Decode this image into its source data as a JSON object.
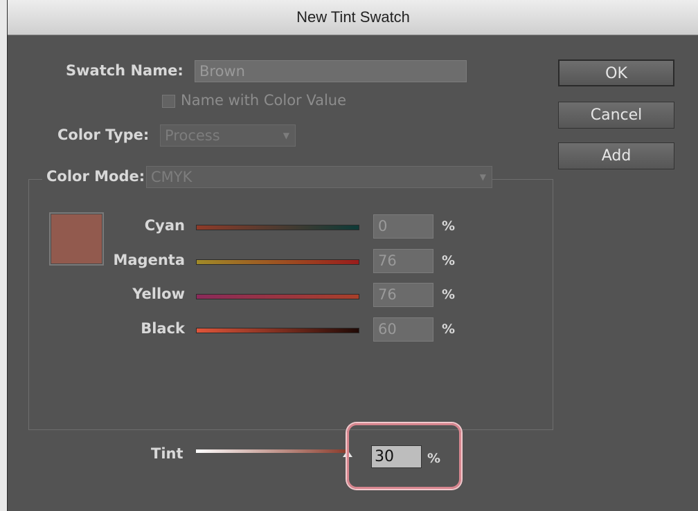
{
  "dialog": {
    "title": "New Tint Swatch"
  },
  "swatch_name": {
    "label": "Swatch Name:",
    "value": "Brown"
  },
  "name_with_color_value": {
    "label": "Name with Color Value",
    "checked": false
  },
  "color_type": {
    "label": "Color Type:",
    "value": "Process"
  },
  "color_mode": {
    "label": "Color Mode:",
    "value": "CMYK"
  },
  "swatch_color": "#925a4e",
  "channels": [
    {
      "label": "Cyan",
      "value": "0",
      "unit": "%",
      "gradient": [
        "#8e3a28",
        "#0d3a37"
      ]
    },
    {
      "label": "Magenta",
      "value": "76",
      "unit": "%",
      "gradient": [
        "#a08a28",
        "#9a1c1c"
      ]
    },
    {
      "label": "Yellow",
      "value": "76",
      "unit": "%",
      "gradient": [
        "#8a2a5a",
        "#a8402a"
      ]
    },
    {
      "label": "Black",
      "value": "60",
      "unit": "%",
      "gradient": [
        "#e0553a",
        "#200a06"
      ]
    }
  ],
  "tint": {
    "label": "Tint",
    "value": "30",
    "unit": "%",
    "level_percent": 30,
    "gradient": [
      "#ffffff",
      "#8a3a2a"
    ]
  },
  "buttons": {
    "ok": "OK",
    "cancel": "Cancel",
    "add": "Add"
  }
}
